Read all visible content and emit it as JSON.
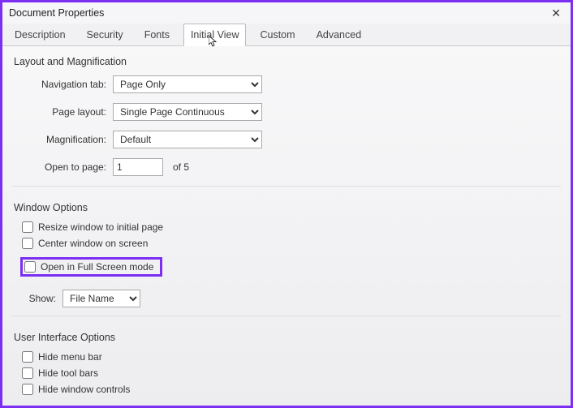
{
  "title": "Document Properties",
  "tabs": {
    "description": "Description",
    "security": "Security",
    "fonts": "Fonts",
    "initial_view": "Initial View",
    "custom": "Custom",
    "advanced": "Advanced"
  },
  "layout": {
    "group_label": "Layout and Magnification",
    "nav_label": "Navigation tab:",
    "nav_value": "Page Only",
    "page_layout_label": "Page layout:",
    "page_layout_value": "Single Page Continuous",
    "mag_label": "Magnification:",
    "mag_value": "Default",
    "open_label": "Open to page:",
    "open_value": "1",
    "open_of": "of 5"
  },
  "window_opts": {
    "group_label": "Window Options",
    "resize": "Resize window to initial page",
    "center": "Center window on screen",
    "fullscreen": "Open in Full Screen mode",
    "show_label": "Show:",
    "show_value": "File Name"
  },
  "ui_opts": {
    "group_label": "User Interface Options",
    "hide_menu": "Hide menu bar",
    "hide_tool": "Hide tool bars",
    "hide_window": "Hide window controls"
  }
}
